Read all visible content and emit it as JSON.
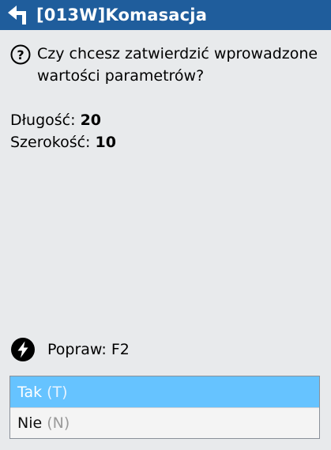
{
  "window": {
    "title": "[013W]Komasacja",
    "back_icon": "back-arrow-icon"
  },
  "dialog": {
    "help_icon": "question-circle-icon",
    "question": "Czy chcesz zatwierdzić wprowadzone wartości parametrów?",
    "params": [
      {
        "label": "Długość:",
        "value": "20"
      },
      {
        "label": "Szerokość:",
        "value": "10"
      }
    ]
  },
  "hint": {
    "icon": "lightning-icon",
    "text": "Popraw: F2"
  },
  "options": [
    {
      "label": "Tak",
      "shortcut": "(T)",
      "selected": true
    },
    {
      "label": "Nie",
      "shortcut": "(N)",
      "selected": false
    }
  ],
  "colors": {
    "titlebar": "#1f5d9c",
    "selected": "#66c3ff",
    "background": "#e8eaec"
  }
}
